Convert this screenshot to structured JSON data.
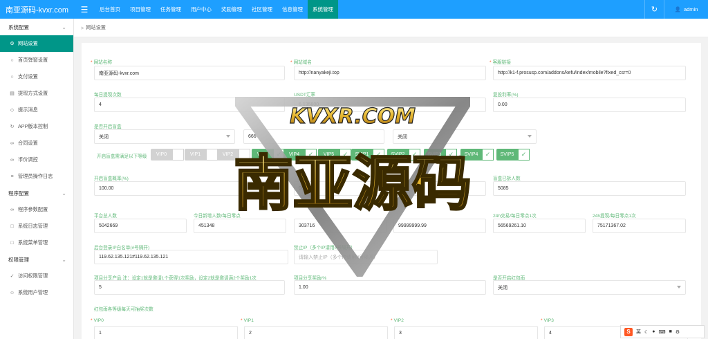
{
  "header": {
    "brand": "南亚源码-kvxr.com",
    "menu_icon": "hamburger-icon",
    "nav": [
      "后台首页",
      "项目管理",
      "任务管理",
      "用户中心",
      "奖励管理",
      "社区管理",
      "信息管理",
      "系统管理"
    ],
    "active_nav": "系统管理",
    "user": "admin"
  },
  "sidebar": {
    "items": [
      {
        "type": "group",
        "label": "系统配置"
      },
      {
        "type": "item",
        "label": "网站设置",
        "icon": "gear-icon",
        "active": true
      },
      {
        "type": "item",
        "label": "首页弹窗设置",
        "icon": "circle-icon"
      },
      {
        "type": "item",
        "label": "支付设置",
        "icon": "circle-icon"
      },
      {
        "type": "item",
        "label": "提现方式设置",
        "icon": "card-icon"
      },
      {
        "type": "item",
        "label": "提示消息",
        "icon": "tag-icon"
      },
      {
        "type": "item",
        "label": "APP版本控制",
        "icon": "refresh-icon"
      },
      {
        "type": "item",
        "label": "合同设置",
        "icon": "link-icon"
      },
      {
        "type": "item",
        "label": "币价调控",
        "icon": "link-icon"
      },
      {
        "type": "item",
        "label": "管理员操作日志",
        "icon": "log-icon"
      },
      {
        "type": "group",
        "label": "程序配置"
      },
      {
        "type": "item",
        "label": "程序参数配置",
        "icon": "link-icon"
      },
      {
        "type": "item",
        "label": "系统日志管理",
        "icon": "doc-icon"
      },
      {
        "type": "item",
        "label": "系统菜单管理",
        "icon": "doc-icon"
      },
      {
        "type": "group",
        "label": "权限管理"
      },
      {
        "type": "item",
        "label": "访问权限管理",
        "icon": "check-circle-icon"
      },
      {
        "type": "item",
        "label": "系统用户管理",
        "icon": "user-icon"
      }
    ]
  },
  "breadcrumb": "网站设置",
  "form": {
    "site_name": {
      "label": "网站名称",
      "value": "南亚源码-kvxr.com"
    },
    "site_domain": {
      "label": "网站域名",
      "value": "http://nanyakeji.top"
    },
    "service_link": {
      "label": "客服链接",
      "value": "http://k1-f.prosusp.com/addons/kefu/index/mobile?fixed_csr=0"
    },
    "daily_withdraw": {
      "label": "每日提现次数",
      "value": "4"
    },
    "usdt_rate": {
      "label": "USDT汇率",
      "value": "6.135800"
    },
    "compound_rate": {
      "label": "复投利率(%)",
      "value": "0.00"
    },
    "open_box": {
      "label": "是否开启盲盒",
      "value": "关闭"
    },
    "mid_value": {
      "value": "666"
    },
    "mid_select": {
      "value": "关闭"
    },
    "box_levels_label": "开启盲盒需满足以下等级",
    "levels": [
      {
        "name": "VIP0",
        "on": false
      },
      {
        "name": "VIP1",
        "on": false
      },
      {
        "name": "VIP2",
        "on": false
      },
      {
        "name": "VIP3",
        "on": true
      },
      {
        "name": "VIP4",
        "on": true
      },
      {
        "name": "VIP5",
        "on": true
      },
      {
        "name": "SVIP1",
        "on": true
      },
      {
        "name": "SVIP2",
        "on": true
      },
      {
        "name": "SVIP3",
        "on": true
      },
      {
        "name": "SVIP4",
        "on": true
      },
      {
        "name": "SVIP5",
        "on": true
      }
    ],
    "box_prob": {
      "label": "开启盲盒概率(%)",
      "value": "100.00"
    },
    "mid_prob": {
      "value": "005"
    },
    "split_count": {
      "label": "盲盒已拆人数",
      "value": "5085"
    },
    "platform_total": {
      "label": "平台总人数",
      "value": "5042669"
    },
    "today_new": {
      "label": "今日新增人数/每日零点",
      "value": "451348"
    },
    "stat3": {
      "value": "303716"
    },
    "stat4": {
      "value": "99999999.99"
    },
    "trade_24h": {
      "label": "24h交易/每日零点1次",
      "value": "56569261.10"
    },
    "withdraw_24h": {
      "label": "24h提现/每日零点1次",
      "value": "75171367.02"
    },
    "login_ip": {
      "label": "后台登录IP白名单(#号隔开)",
      "value": "119.62.135.121#119.62.135.121"
    },
    "ban_ip": {
      "label": "禁止IP（多个IP请用#号隔开）",
      "placeholder": "请输入禁止IP（多个IP请用#号隔开）"
    },
    "share_product": {
      "label": "项目分享产品 注：设定1就是邀请1个获得1次奖励，设定2就是邀请满2个奖励1次",
      "value": "5"
    },
    "share_reward": {
      "label": "项目分享奖励/%",
      "value": "1.00"
    },
    "red_packet": {
      "label": "是否开启红包雨",
      "value": "关闭"
    },
    "red_levels_label": "红包雨各等级每天可抽奖次数",
    "vip_counts": [
      {
        "label": "VIP0",
        "value": "1"
      },
      {
        "label": "VIP1",
        "value": "2"
      },
      {
        "label": "VIP2",
        "value": "3"
      },
      {
        "label": "VIP3",
        "value": "4"
      }
    ]
  },
  "watermark": {
    "top_text": "KVXR.COM",
    "main_text": "南亚源码"
  },
  "ime": {
    "s": "S",
    "lang": "英"
  },
  "colors": {
    "primary": "#1e9fff",
    "active": "#009688",
    "label": "#5fb878",
    "required": "#ff5722"
  }
}
